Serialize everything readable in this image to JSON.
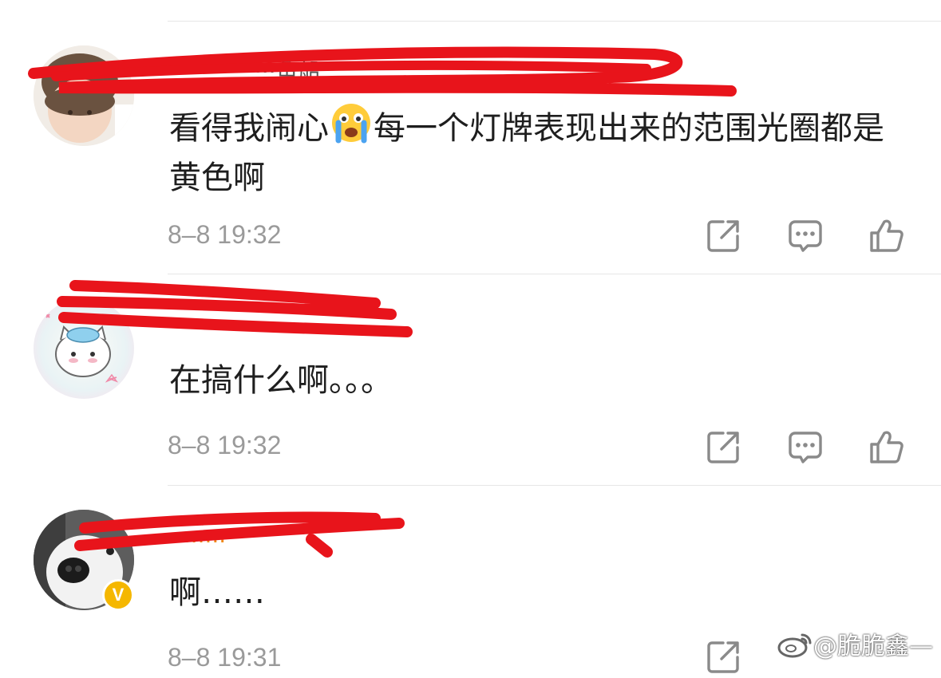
{
  "comments": [
    {
      "nickname": "···············鱼船",
      "text_before_emoji": "看得我闹心",
      "emoji": "crying-face",
      "text_after_emoji": "每一个灯牌表现出来的范围光圈都是黄色啊",
      "time": "8–8 19:32"
    },
    {
      "nickname": "·········",
      "text": "在搞什么啊。。。",
      "time": "8–8 19:32"
    },
    {
      "nickname": "········",
      "text": "啊……",
      "time": "8–8 19:31",
      "verified_badge": "V"
    }
  ],
  "actions": [
    "share-icon",
    "comment-icon",
    "like-icon"
  ],
  "watermark": "@脆脆鑫—",
  "colors": {
    "redact": "#e8141b",
    "time": "#9a9a9a",
    "badge": "#f5b700",
    "divider": "#e6e6e6"
  }
}
